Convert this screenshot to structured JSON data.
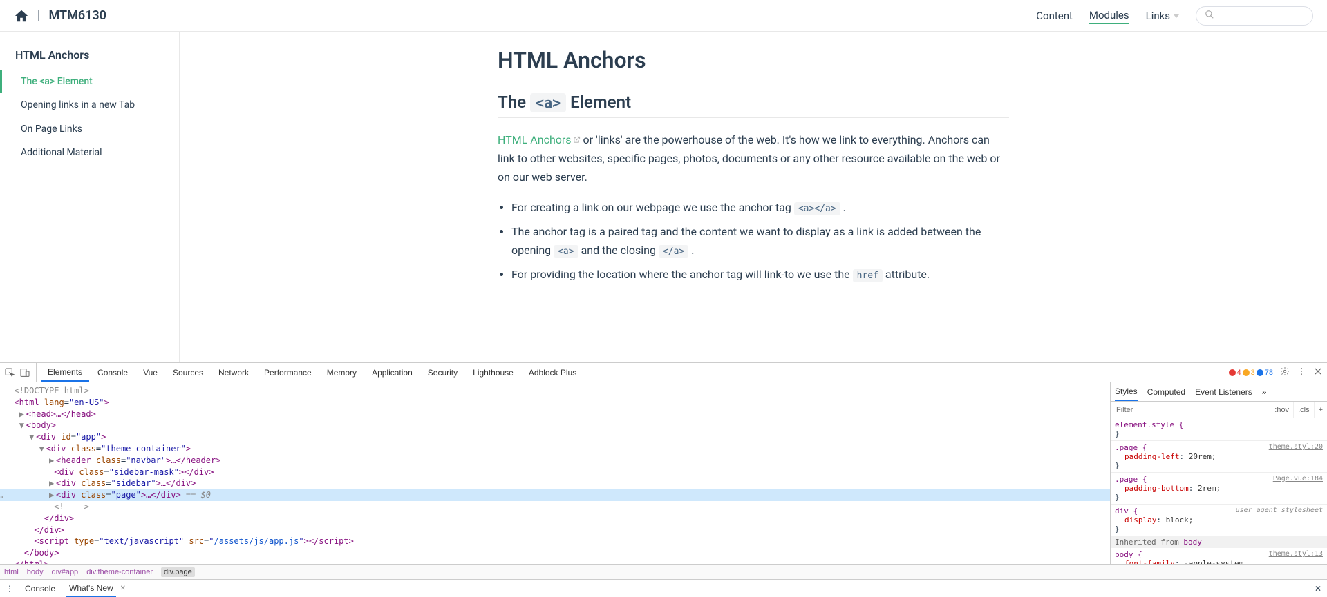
{
  "navbar": {
    "site_title": "MTM6130",
    "links": [
      "Content",
      "Modules",
      "Links"
    ],
    "active_index": 1,
    "search_placeholder": ""
  },
  "sidebar": {
    "heading": "HTML Anchors",
    "items": [
      "The <a> Element",
      "Opening links in a new Tab",
      "On Page Links",
      "Additional Material"
    ],
    "active_index": 0
  },
  "article": {
    "h1": "HTML Anchors",
    "h2_pre": "The ",
    "h2_code": "<a>",
    "h2_post": " Element",
    "link_text": "HTML Anchors",
    "para_after_link": " or 'links' are the powerhouse of the web. It's how we link to everything. Anchors can link to other websites, specific pages, photos, documents or any other resource available on the web or on our web server.",
    "li1_pre": "For creating a link on our webpage we use the anchor tag ",
    "li1_code": "<a></a>",
    "li1_post": " .",
    "li2_pre": "The anchor tag is a paired tag and the content we want to display as a link is added between the opening ",
    "li2_code1": "<a>",
    "li2_mid": " and the closing ",
    "li2_code2": "</a>",
    "li2_post": " .",
    "li3_pre": "For providing the location where the anchor tag will link-to we use the ",
    "li3_code": "href",
    "li3_post": " attribute."
  },
  "devtools": {
    "main_tabs": [
      "Elements",
      "Console",
      "Vue",
      "Sources",
      "Network",
      "Performance",
      "Memory",
      "Application",
      "Security",
      "Lighthouse",
      "Adblock Plus"
    ],
    "main_active": 0,
    "status": {
      "errors": "4",
      "warnings": "3",
      "messages": "78"
    },
    "breadcrumb": [
      "html",
      "body",
      "div#app",
      "div.theme-container",
      "div.page"
    ],
    "breadcrumb_selected": 4,
    "styles_tabs": [
      "Styles",
      "Computed",
      "Event Listeners"
    ],
    "styles_active": 0,
    "filter_placeholder": "Filter",
    "hov": ":hov",
    "cls": ".cls",
    "rules": {
      "elstyle_sel": "element.style {",
      "r1_sel": ".page {",
      "r1_src": "theme.styl:20",
      "r1_prop": "padding-left",
      "r1_val": "20rem;",
      "r2_sel": ".page {",
      "r2_src": "Page.vue:184",
      "r2_prop": "padding-bottom",
      "r2_val": "2rem;",
      "r3_sel": "div {",
      "r3_src": "user agent stylesheet",
      "r3_prop": "display",
      "r3_val": "block;",
      "inherit_hdr": "Inherited from ",
      "inherit_sel": "body",
      "r4_sel": "body {",
      "r4_src": "theme.styl:13",
      "r4_prop": "font-family",
      "r4_val": "-apple-system, BlinkMacSystemFont, \"Segoe UI\", Roboto, Oxygen, Ubuntu, Cantarell, \"Fira Sans\", \"Droid Sans\","
    },
    "dom": {
      "l0": "<!DOCTYPE html>",
      "l1_open": "<html ",
      "l1_attr": "lang",
      "l1_val": "\"en-US\"",
      "l1_close": ">",
      "l2": "<head>…</head>",
      "l3": "<body>",
      "l4_open": "<div ",
      "l4_attr": "id",
      "l4_val": "\"app\"",
      "l4_close": ">",
      "l5_open": "<div ",
      "l5_attr": "class",
      "l5_val": "\"theme-container\"",
      "l5_close": ">",
      "l6_open": "<header ",
      "l6_attr": "class",
      "l6_val": "\"navbar\"",
      "l6_mid": ">…",
      "l6_close": "</header>",
      "l7_open": "<div ",
      "l7_attr": "class",
      "l7_val": "\"sidebar-mask\"",
      "l7_mid": ">",
      "l7_close": "</div>",
      "l8_open": "<div ",
      "l8_attr": "class",
      "l8_val": "\"sidebar\"",
      "l8_mid": ">…",
      "l8_close": "</div>",
      "l9_open": "<div ",
      "l9_attr": "class",
      "l9_val": "\"page\"",
      "l9_mid": ">…",
      "l9_close": "</div>",
      "l9_eq": " == $0",
      "l10": "<!---->",
      "l11": "</div>",
      "l12": "</div>",
      "l13_open": "<script ",
      "l13_a1": "type",
      "l13_v1": "\"text/javascript\"",
      "l13_a2": "src",
      "l13_v2": "\"",
      "l13_link": "/assets/js/app.js",
      "l13_v2b": "\"",
      "l13_mid": ">",
      "l13_close": "</script>",
      "l14": "</body>",
      "l15": "</html>"
    },
    "drawer_tabs": [
      "Console",
      "What's New"
    ],
    "drawer_active": 1
  }
}
